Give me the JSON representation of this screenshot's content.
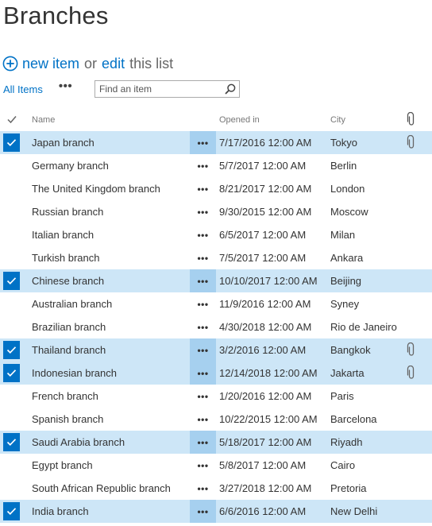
{
  "page_title": "Branches",
  "commands": {
    "new_item": "new item",
    "or": "or",
    "edit": "edit",
    "this_list": "this list"
  },
  "views": {
    "all_items": "All Items",
    "more": "•••"
  },
  "search": {
    "placeholder": "Find an item",
    "value": ""
  },
  "columns": {
    "name": "Name",
    "opened_in": "Opened in",
    "city": "City"
  },
  "accent_color": "#0072c6",
  "selected_row_color": "#cde6f7",
  "icons": {
    "new": "plus-circle-icon",
    "search": "magnifier-icon",
    "attachment": "paperclip-icon",
    "select": "checkmark-icon"
  },
  "rows": [
    {
      "name": "Japan branch",
      "opened": "7/17/2016 12:00 AM",
      "city": "Tokyo",
      "selected": true,
      "attachment": true,
      "menu": "•••"
    },
    {
      "name": "Germany branch",
      "opened": "5/7/2017 12:00 AM",
      "city": "Berlin",
      "selected": false,
      "attachment": false,
      "menu": "•••"
    },
    {
      "name": "The United Kingdom branch",
      "opened": "8/21/2017 12:00 AM",
      "city": "London",
      "selected": false,
      "attachment": false,
      "menu": "•••"
    },
    {
      "name": "Russian branch",
      "opened": "9/30/2015 12:00 AM",
      "city": "Moscow",
      "selected": false,
      "attachment": false,
      "menu": "•••"
    },
    {
      "name": "Italian branch",
      "opened": "6/5/2017 12:00 AM",
      "city": "Milan",
      "selected": false,
      "attachment": false,
      "menu": "•••"
    },
    {
      "name": "Turkish branch",
      "opened": "7/5/2017 12:00 AM",
      "city": "Ankara",
      "selected": false,
      "attachment": false,
      "menu": "•••"
    },
    {
      "name": "Chinese branch",
      "opened": "10/10/2017 12:00 AM",
      "city": "Beijing",
      "selected": true,
      "attachment": false,
      "menu": "•••"
    },
    {
      "name": "Australian branch",
      "opened": "11/9/2016 12:00 AM",
      "city": "Syney",
      "selected": false,
      "attachment": false,
      "menu": "•••"
    },
    {
      "name": "Brazilian branch",
      "opened": "4/30/2018 12:00 AM",
      "city": "Rio de Janeiro",
      "selected": false,
      "attachment": false,
      "menu": "•••"
    },
    {
      "name": "Thailand branch",
      "opened": "3/2/2016 12:00 AM",
      "city": "Bangkok",
      "selected": true,
      "attachment": true,
      "menu": "•••"
    },
    {
      "name": "Indonesian branch",
      "opened": "12/14/2018 12:00 AM",
      "city": "Jakarta",
      "selected": true,
      "attachment": true,
      "menu": "•••"
    },
    {
      "name": "French branch",
      "opened": "1/20/2016 12:00 AM",
      "city": "Paris",
      "selected": false,
      "attachment": false,
      "menu": "•••"
    },
    {
      "name": "Spanish branch",
      "opened": "10/22/2015 12:00 AM",
      "city": "Barcelona",
      "selected": false,
      "attachment": false,
      "menu": "•••"
    },
    {
      "name": "Saudi Arabia branch",
      "opened": "5/18/2017 12:00 AM",
      "city": "Riyadh",
      "selected": true,
      "attachment": false,
      "menu": "•••"
    },
    {
      "name": "Egypt branch",
      "opened": "5/8/2017 12:00 AM",
      "city": "Cairo",
      "selected": false,
      "attachment": false,
      "menu": "•••"
    },
    {
      "name": "South African Republic branch",
      "opened": "3/27/2018 12:00 AM",
      "city": "Pretoria",
      "selected": false,
      "attachment": false,
      "menu": "•••"
    },
    {
      "name": "India branch",
      "opened": "6/6/2016 12:00 AM",
      "city": "New Delhi",
      "selected": true,
      "attachment": false,
      "menu": "•••"
    }
  ]
}
